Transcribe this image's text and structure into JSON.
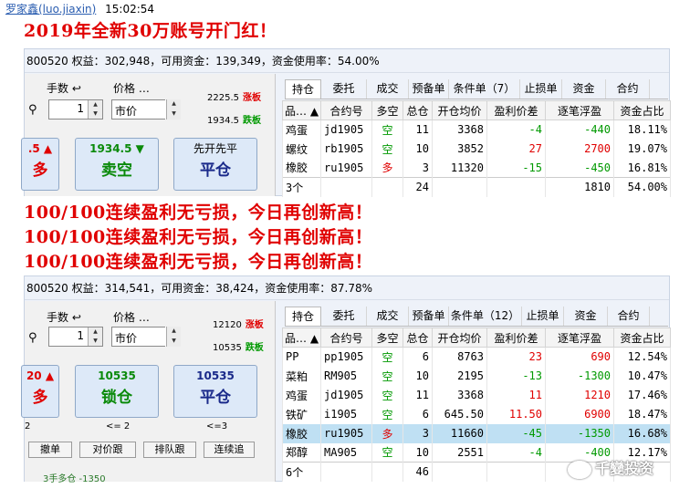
{
  "chat": {
    "sender": "罗家鑫(luo.jiaxin)",
    "time": "15:02:54"
  },
  "banner_top": "2019年全新30万账号开门红！",
  "banner_mid": [
    "100/100连续盈利无亏损，今日再创新高！",
    "100/100连续盈利无亏损，今日再创新高！",
    "100/100连续盈利无亏损，今日再创新高！"
  ],
  "panel1": {
    "account_line": "800520 权益：302,948，可用资金：139,349，资金使用率：54.00%",
    "order": {
      "qty_label": "手数",
      "qty_value": "1",
      "price_label": "价格 …",
      "price_value": "市价",
      "limit_up": "2225.5",
      "limit_up_label": "涨板",
      "limit_down": "1934.5",
      "limit_down_label": "跌板",
      "buy_price": ".5 ▲",
      "buy_action": "多",
      "sell_price": "1934.5 ▼",
      "sell_action": "卖空",
      "close_price": "先开先平",
      "close_action": "平仓"
    },
    "tabs": [
      "持仓",
      "委托",
      "成交",
      "预备单",
      "条件单（7）",
      "止损单",
      "资金",
      "合约"
    ],
    "headers": [
      "品… ▲",
      "合约号",
      "多空",
      "总仓",
      "开仓均价",
      "盈利价差",
      "逐笔浮盈",
      "资金占比"
    ],
    "rows": [
      {
        "name": "鸡蛋",
        "code": "jd1905",
        "dir": "空",
        "qty": "11",
        "avg": "3368",
        "spread": "-4",
        "pnl": "-440",
        "ratio": "18.11%"
      },
      {
        "name": "螺纹",
        "code": "rb1905",
        "dir": "空",
        "qty": "10",
        "avg": "3852",
        "spread": "27",
        "pnl": "2700",
        "ratio": "19.07%"
      },
      {
        "name": "橡胶",
        "code": "ru1905",
        "dir": "多",
        "qty": "3",
        "avg": "11320",
        "spread": "-15",
        "pnl": "-450",
        "ratio": "16.81%"
      }
    ],
    "total": {
      "name": "3个",
      "qty": "24",
      "pnl": "1810",
      "ratio": "54.00%"
    }
  },
  "panel2": {
    "account_line": "800520 权益：314,541，可用资金：38,424，资金使用率：87.78%",
    "order": {
      "qty_label": "手数",
      "qty_value": "1",
      "price_label": "价格 …",
      "price_value": "市价",
      "limit_up": "12120",
      "limit_up_label": "涨板",
      "limit_down": "10535",
      "limit_down_label": "跌板",
      "buy_price": "20 ▲",
      "buy_action": "多",
      "lock_price": "10535",
      "lock_action": "锁仓",
      "close_price": "10535",
      "close_action": "平仓",
      "lock_sub": "<= 2",
      "close_sub": "<=3",
      "left_sub": "2",
      "buttons": [
        "撤单",
        "对价跟",
        "排队跟",
        "连续追"
      ],
      "footer_text": "3手多仓 -1350"
    },
    "tabs": [
      "持仓",
      "委托",
      "成交",
      "预备单",
      "条件单（12）",
      "止损单",
      "资金",
      "合约"
    ],
    "headers": [
      "品… ▲",
      "合约号",
      "多空",
      "总仓",
      "开仓均价",
      "盈利价差",
      "逐笔浮盈",
      "资金占比"
    ],
    "rows": [
      {
        "name": "PP",
        "code": "pp1905",
        "dir": "空",
        "qty": "6",
        "avg": "8763",
        "spread": "23",
        "pnl": "690",
        "ratio": "12.54%"
      },
      {
        "name": "菜粕",
        "code": "RM905",
        "dir": "空",
        "qty": "10",
        "avg": "2195",
        "spread": "-13",
        "pnl": "-1300",
        "ratio": "10.47%"
      },
      {
        "name": "鸡蛋",
        "code": "jd1905",
        "dir": "空",
        "qty": "11",
        "avg": "3368",
        "spread": "11",
        "pnl": "1210",
        "ratio": "17.46%"
      },
      {
        "name": "铁矿",
        "code": "i1905",
        "dir": "空",
        "qty": "6",
        "avg": "645.50",
        "spread": "11.50",
        "pnl": "6900",
        "ratio": "18.47%"
      },
      {
        "name": "橡胶",
        "code": "ru1905",
        "dir": "多",
        "qty": "3",
        "avg": "11660",
        "spread": "-45",
        "pnl": "-1350",
        "ratio": "16.68%"
      },
      {
        "name": "郑醇",
        "code": "MA905",
        "dir": "空",
        "qty": "10",
        "avg": "2551",
        "spread": "-4",
        "pnl": "-400",
        "ratio": "12.17%"
      }
    ],
    "total": {
      "name": "6个",
      "qty": "46",
      "pnl": "",
      "ratio": ""
    }
  },
  "watermark": "千變投资",
  "colors": {
    "profit": "#e00000",
    "loss": "#009900",
    "highlight_row": "#bfe0f3",
    "banner": "#e00000"
  }
}
